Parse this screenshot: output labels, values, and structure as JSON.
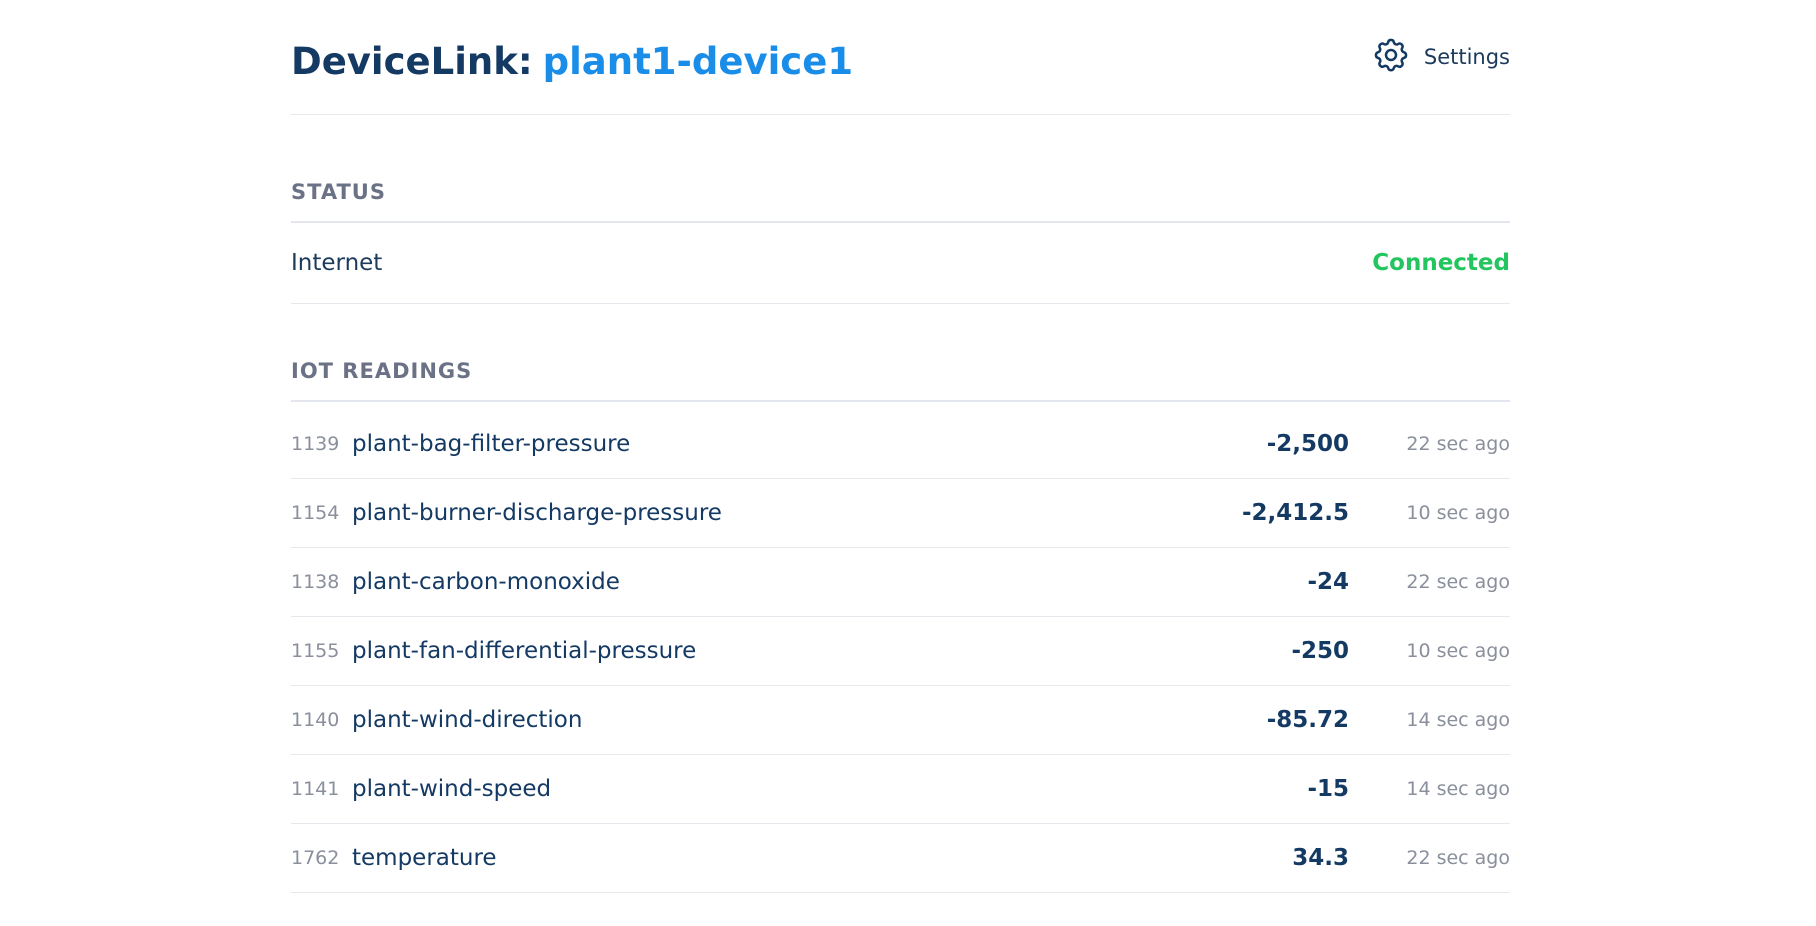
{
  "header": {
    "title_prefix": "DeviceLink:",
    "device_name": "plant1-device1",
    "settings_label": "Settings",
    "settings_icon": "gear-icon"
  },
  "status": {
    "section_title": "STATUS",
    "items": [
      {
        "label": "Internet",
        "value": "Connected",
        "value_color": "#22c55e"
      }
    ]
  },
  "iot": {
    "section_title": "IOT READINGS",
    "readings": [
      {
        "id": "1139",
        "name": "plant-bag-filter-pressure",
        "value": "-2,500",
        "time": "22 sec ago"
      },
      {
        "id": "1154",
        "name": "plant-burner-discharge-pressure",
        "value": "-2,412.5",
        "time": "10 sec ago"
      },
      {
        "id": "1138",
        "name": "plant-carbon-monoxide",
        "value": "-24",
        "time": "22 sec ago"
      },
      {
        "id": "1155",
        "name": "plant-fan-differential-pressure",
        "value": "-250",
        "time": "10 sec ago"
      },
      {
        "id": "1140",
        "name": "plant-wind-direction",
        "value": "-85.72",
        "time": "14 sec ago"
      },
      {
        "id": "1141",
        "name": "plant-wind-speed",
        "value": "-15",
        "time": "14 sec ago"
      },
      {
        "id": "1762",
        "name": "temperature",
        "value": "34.3",
        "time": "22 sec ago"
      }
    ]
  },
  "colors": {
    "accent": "#1a8de9",
    "primary_text": "#143a63",
    "muted_text": "#8a8f9c",
    "section_title": "#6b7286",
    "connected": "#22c55e"
  }
}
